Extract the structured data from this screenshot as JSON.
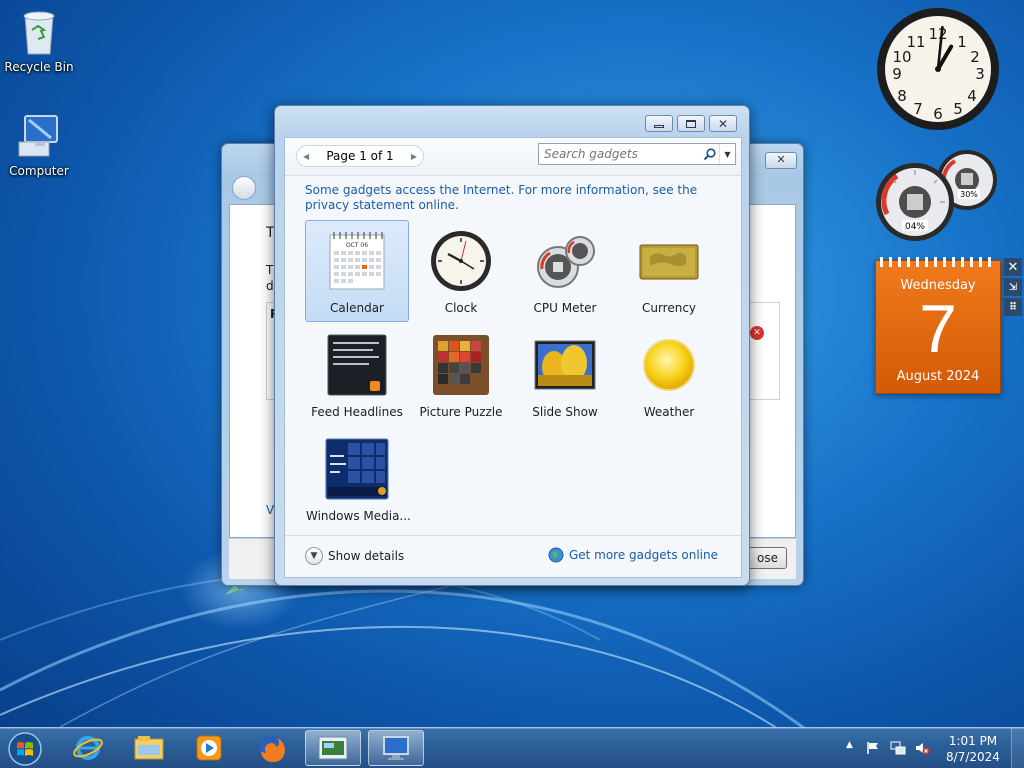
{
  "desktop": {
    "icons": [
      {
        "label": "Recycle Bin",
        "icon": "recycle-bin-icon"
      },
      {
        "label": "Computer",
        "icon": "computer-icon"
      }
    ]
  },
  "back_window": {
    "visible_text": {
      "t1": "T",
      "t2": "T",
      "t3": "d",
      "t4": "P",
      "t5": "V"
    },
    "close_btn": "ose"
  },
  "gallery": {
    "page_label": "Page 1 of 1",
    "search_placeholder": "Search gadgets",
    "notice": "Some gadgets access the Internet.  For more information, see the privacy statement online.",
    "gadgets": [
      {
        "label": "Calendar",
        "icon": "calendar-gadget-icon",
        "selected": true
      },
      {
        "label": "Clock",
        "icon": "clock-gadget-icon"
      },
      {
        "label": "CPU Meter",
        "icon": "cpu-meter-gadget-icon"
      },
      {
        "label": "Currency",
        "icon": "currency-gadget-icon"
      },
      {
        "label": "Feed Headlines",
        "icon": "feed-headlines-gadget-icon"
      },
      {
        "label": "Picture Puzzle",
        "icon": "picture-puzzle-gadget-icon"
      },
      {
        "label": "Slide Show",
        "icon": "slide-show-gadget-icon"
      },
      {
        "label": "Weather",
        "icon": "weather-gadget-icon"
      },
      {
        "label": "Windows Media...",
        "icon": "windows-media-gadget-icon"
      }
    ],
    "show_details": "Show details",
    "get_more": "Get more gadgets online",
    "calendar_thumb_month": "OCT 06"
  },
  "desk_gadgets": {
    "clock": {
      "hour": 1,
      "minute": 1,
      "numbers": [
        "12",
        "1",
        "2",
        "3",
        "4",
        "5",
        "6",
        "7",
        "8",
        "9",
        "10",
        "11"
      ]
    },
    "cpu_meter": {
      "cpu_percent": "04%",
      "memory_percent": "30%"
    },
    "calendar": {
      "weekday": "Wednesday",
      "day": "7",
      "month_year": "August 2024"
    }
  },
  "taskbar": {
    "time": "1:01 PM",
    "date": "8/7/2024",
    "pinned": [
      "internet-explorer-icon",
      "explorer-icon",
      "media-player-icon",
      "firefox-icon",
      "gadget-window-icon",
      "remote-desktop-icon"
    ]
  },
  "colors": {
    "link": "#1d5ca8",
    "calendar_orange": "#e66b12",
    "taskbar": "#2b5d95"
  }
}
